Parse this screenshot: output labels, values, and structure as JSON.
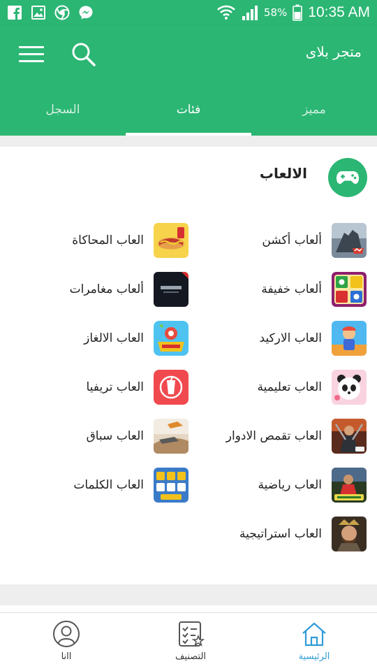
{
  "status_bar": {
    "battery_percent": "58%",
    "time": "10:35 AM",
    "left_icons": [
      "facebook-icon",
      "gallery-icon",
      "chrome-icon",
      "messenger-icon"
    ],
    "right_icons": [
      "wifi-icon",
      "signal-icon",
      "battery-icon"
    ]
  },
  "app_bar": {
    "title": "متجر بلاى",
    "menu_icon": "hamburger-menu-icon",
    "search_icon": "search-icon",
    "tabs": [
      {
        "label": "مميز",
        "active": false
      },
      {
        "label": "فئات",
        "active": true
      },
      {
        "label": "السجل",
        "active": false
      }
    ]
  },
  "section": {
    "title": "الالعاب",
    "icon": "gamepad-icon",
    "categories_right": [
      {
        "label": "ألعاب أكشن",
        "icon": "free-fire-thumbnail"
      },
      {
        "label": "ألعاب خفيفة",
        "icon": "ludo-thumbnail"
      },
      {
        "label": "العاب الاركيد",
        "icon": "subway-surfers-thumbnail"
      },
      {
        "label": "العاب تعليمية",
        "icon": "baby-panda-thumbnail"
      },
      {
        "label": "العاب تقمص الادوار",
        "icon": "warrior-game-thumbnail"
      },
      {
        "label": "العاب رياضية",
        "icon": "pes-soccer-thumbnail"
      },
      {
        "label": "العاب استراتيجية",
        "icon": "strategy-hero-thumbnail"
      }
    ],
    "categories_left": [
      {
        "label": "العاب المحاكاة",
        "icon": "hotdog-cooking-thumbnail"
      },
      {
        "label": "ألعاب مغامرات",
        "icon": "dark-adventure-thumbnail"
      },
      {
        "label": "العاب الالغاز",
        "icon": "word-puzzle-thumbnail"
      },
      {
        "label": "العاب تريفيا",
        "icon": "trivia-cup-thumbnail"
      },
      {
        "label": "العاب سباق",
        "icon": "racing-game-thumbnail"
      },
      {
        "label": "العاب الكلمات",
        "icon": "word-tiles-thumbnail"
      }
    ]
  },
  "bottom_nav": [
    {
      "label": "اانا",
      "icon": "profile-icon",
      "active": false
    },
    {
      "label": "التصنيف",
      "icon": "checklist-icon",
      "active": false
    },
    {
      "label": "الرئيسية",
      "icon": "home-icon",
      "active": true
    }
  ],
  "colors": {
    "primary": "#2bb673",
    "active_nav": "#2e9cd6",
    "background_gap": "#eeeeee"
  }
}
